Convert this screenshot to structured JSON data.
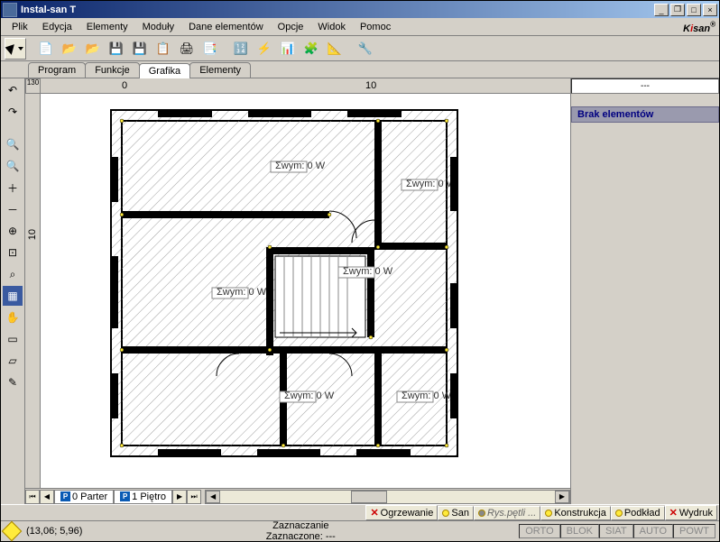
{
  "window": {
    "title": "Instal-san T"
  },
  "menu": [
    "Plik",
    "Edycja",
    "Elementy",
    "Moduły",
    "Dane elementów",
    "Opcje",
    "Widok",
    "Pomoc"
  ],
  "logo": {
    "prefix": "K",
    "accent": "i",
    "suffix": "san"
  },
  "tabs": [
    "Program",
    "Funkcje",
    "Grafika",
    "Elementy"
  ],
  "activeTab": 2,
  "ruler": {
    "corner": "130",
    "h0": "0",
    "h10": "10",
    "v10": "10"
  },
  "floorTabs": [
    {
      "icon": "P",
      "label": "0 Parter"
    },
    {
      "icon": "P",
      "label": "1 Piętro"
    }
  ],
  "rightPanel": {
    "header": "---",
    "item": "Brak elementów"
  },
  "layers": [
    {
      "x": true,
      "label": "Ogrzewanie"
    },
    {
      "bulb": true,
      "label": "San"
    },
    {
      "bulb": "off",
      "label": "Rys.pętli ...",
      "italic": true
    },
    {
      "bulb": true,
      "label": "Konstrukcja"
    },
    {
      "bulb": true,
      "label": "Podkład"
    },
    {
      "x": true,
      "label": "Wydruk"
    }
  ],
  "status": {
    "coords": "(13,06; 5,96)",
    "mode": "Zaznaczanie",
    "selection": "Zaznaczone: ---",
    "slots": [
      "ORTO",
      "BLOK",
      "SIAT",
      "AUTO",
      "POWT"
    ]
  }
}
